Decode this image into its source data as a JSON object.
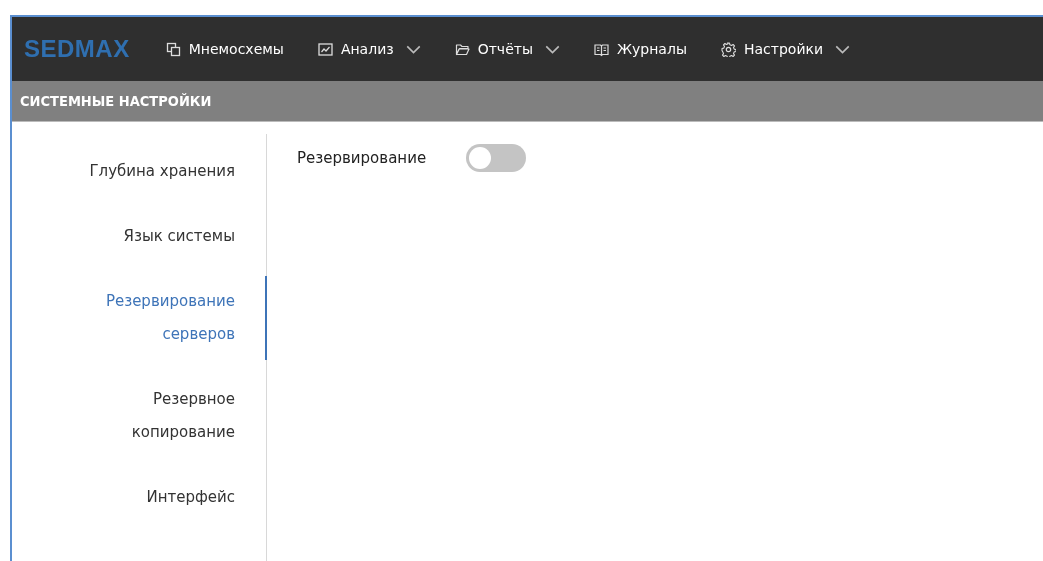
{
  "logo": "SEDMAX",
  "menu": [
    {
      "label": "Мнемосхемы",
      "kind": "windows",
      "dropdown": false
    },
    {
      "label": "Анализ",
      "kind": "chart",
      "dropdown": true
    },
    {
      "label": "Отчёты",
      "kind": "folder",
      "dropdown": true
    },
    {
      "label": "Журналы",
      "kind": "book",
      "dropdown": false
    },
    {
      "label": "Настройки",
      "kind": "gear",
      "dropdown": true
    }
  ],
  "page_title": "СИСТЕМНЫЕ НАСТРОЙКИ",
  "sidebar": {
    "items": [
      {
        "label": "Глубина хранения",
        "selected": false
      },
      {
        "label": "Язык системы",
        "selected": false
      },
      {
        "label": "Резервирование серверов",
        "selected": true
      },
      {
        "label": "Резервное копирование",
        "selected": false
      },
      {
        "label": "Интерфейс",
        "selected": false
      }
    ]
  },
  "settings": [
    {
      "label": "Резервирование",
      "on": false
    }
  ]
}
